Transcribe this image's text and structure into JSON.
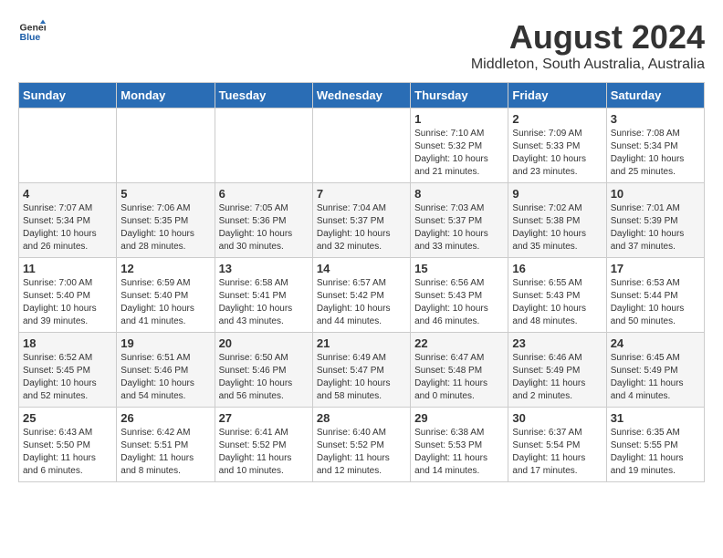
{
  "header": {
    "logo_general": "General",
    "logo_blue": "Blue",
    "title": "August 2024",
    "subtitle": "Middleton, South Australia, Australia"
  },
  "days_of_week": [
    "Sunday",
    "Monday",
    "Tuesday",
    "Wednesday",
    "Thursday",
    "Friday",
    "Saturday"
  ],
  "weeks": [
    [
      {
        "day": "",
        "info": ""
      },
      {
        "day": "",
        "info": ""
      },
      {
        "day": "",
        "info": ""
      },
      {
        "day": "",
        "info": ""
      },
      {
        "day": "1",
        "info": "Sunrise: 7:10 AM\nSunset: 5:32 PM\nDaylight: 10 hours\nand 21 minutes."
      },
      {
        "day": "2",
        "info": "Sunrise: 7:09 AM\nSunset: 5:33 PM\nDaylight: 10 hours\nand 23 minutes."
      },
      {
        "day": "3",
        "info": "Sunrise: 7:08 AM\nSunset: 5:34 PM\nDaylight: 10 hours\nand 25 minutes."
      }
    ],
    [
      {
        "day": "4",
        "info": "Sunrise: 7:07 AM\nSunset: 5:34 PM\nDaylight: 10 hours\nand 26 minutes."
      },
      {
        "day": "5",
        "info": "Sunrise: 7:06 AM\nSunset: 5:35 PM\nDaylight: 10 hours\nand 28 minutes."
      },
      {
        "day": "6",
        "info": "Sunrise: 7:05 AM\nSunset: 5:36 PM\nDaylight: 10 hours\nand 30 minutes."
      },
      {
        "day": "7",
        "info": "Sunrise: 7:04 AM\nSunset: 5:37 PM\nDaylight: 10 hours\nand 32 minutes."
      },
      {
        "day": "8",
        "info": "Sunrise: 7:03 AM\nSunset: 5:37 PM\nDaylight: 10 hours\nand 33 minutes."
      },
      {
        "day": "9",
        "info": "Sunrise: 7:02 AM\nSunset: 5:38 PM\nDaylight: 10 hours\nand 35 minutes."
      },
      {
        "day": "10",
        "info": "Sunrise: 7:01 AM\nSunset: 5:39 PM\nDaylight: 10 hours\nand 37 minutes."
      }
    ],
    [
      {
        "day": "11",
        "info": "Sunrise: 7:00 AM\nSunset: 5:40 PM\nDaylight: 10 hours\nand 39 minutes."
      },
      {
        "day": "12",
        "info": "Sunrise: 6:59 AM\nSunset: 5:40 PM\nDaylight: 10 hours\nand 41 minutes."
      },
      {
        "day": "13",
        "info": "Sunrise: 6:58 AM\nSunset: 5:41 PM\nDaylight: 10 hours\nand 43 minutes."
      },
      {
        "day": "14",
        "info": "Sunrise: 6:57 AM\nSunset: 5:42 PM\nDaylight: 10 hours\nand 44 minutes."
      },
      {
        "day": "15",
        "info": "Sunrise: 6:56 AM\nSunset: 5:43 PM\nDaylight: 10 hours\nand 46 minutes."
      },
      {
        "day": "16",
        "info": "Sunrise: 6:55 AM\nSunset: 5:43 PM\nDaylight: 10 hours\nand 48 minutes."
      },
      {
        "day": "17",
        "info": "Sunrise: 6:53 AM\nSunset: 5:44 PM\nDaylight: 10 hours\nand 50 minutes."
      }
    ],
    [
      {
        "day": "18",
        "info": "Sunrise: 6:52 AM\nSunset: 5:45 PM\nDaylight: 10 hours\nand 52 minutes."
      },
      {
        "day": "19",
        "info": "Sunrise: 6:51 AM\nSunset: 5:46 PM\nDaylight: 10 hours\nand 54 minutes."
      },
      {
        "day": "20",
        "info": "Sunrise: 6:50 AM\nSunset: 5:46 PM\nDaylight: 10 hours\nand 56 minutes."
      },
      {
        "day": "21",
        "info": "Sunrise: 6:49 AM\nSunset: 5:47 PM\nDaylight: 10 hours\nand 58 minutes."
      },
      {
        "day": "22",
        "info": "Sunrise: 6:47 AM\nSunset: 5:48 PM\nDaylight: 11 hours\nand 0 minutes."
      },
      {
        "day": "23",
        "info": "Sunrise: 6:46 AM\nSunset: 5:49 PM\nDaylight: 11 hours\nand 2 minutes."
      },
      {
        "day": "24",
        "info": "Sunrise: 6:45 AM\nSunset: 5:49 PM\nDaylight: 11 hours\nand 4 minutes."
      }
    ],
    [
      {
        "day": "25",
        "info": "Sunrise: 6:43 AM\nSunset: 5:50 PM\nDaylight: 11 hours\nand 6 minutes."
      },
      {
        "day": "26",
        "info": "Sunrise: 6:42 AM\nSunset: 5:51 PM\nDaylight: 11 hours\nand 8 minutes."
      },
      {
        "day": "27",
        "info": "Sunrise: 6:41 AM\nSunset: 5:52 PM\nDaylight: 11 hours\nand 10 minutes."
      },
      {
        "day": "28",
        "info": "Sunrise: 6:40 AM\nSunset: 5:52 PM\nDaylight: 11 hours\nand 12 minutes."
      },
      {
        "day": "29",
        "info": "Sunrise: 6:38 AM\nSunset: 5:53 PM\nDaylight: 11 hours\nand 14 minutes."
      },
      {
        "day": "30",
        "info": "Sunrise: 6:37 AM\nSunset: 5:54 PM\nDaylight: 11 hours\nand 17 minutes."
      },
      {
        "day": "31",
        "info": "Sunrise: 6:35 AM\nSunset: 5:55 PM\nDaylight: 11 hours\nand 19 minutes."
      }
    ]
  ]
}
